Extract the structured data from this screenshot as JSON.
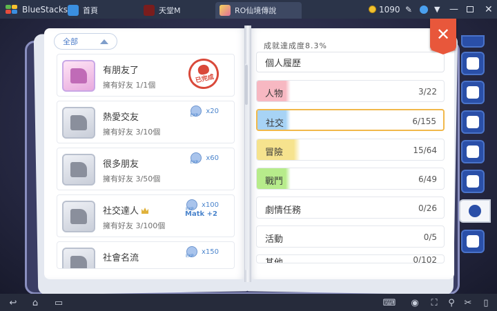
{
  "titlebar": {
    "app_name": "BlueStacks",
    "tabs": [
      {
        "label": "首頁",
        "icon": "home-icon"
      },
      {
        "label": "天堂M",
        "icon": "lineage-m-icon"
      },
      {
        "label": "RO仙境傳說",
        "icon": "ro-game-icon"
      }
    ],
    "coins": "1090",
    "icons": [
      "coin-icon",
      "pin-icon",
      "bluestacks-logo-icon",
      "minimize-icon",
      "maximize-icon",
      "close-icon"
    ]
  },
  "book": {
    "filter_label": "全部",
    "achievements": [
      {
        "name": "有朋友了",
        "desc": "擁有好友 1/1個",
        "completed": true,
        "stamp": "已完成"
      },
      {
        "name": "熱愛交友",
        "desc": "擁有好友 3/10個",
        "reward": "x20"
      },
      {
        "name": "很多朋友",
        "desc": "擁有好友 3/50個",
        "reward": "x60"
      },
      {
        "name": "社交達人",
        "desc": "擁有好友 3/100個",
        "reward": "x100",
        "bonus": "Matk +2"
      },
      {
        "name": "社會名流",
        "desc": "",
        "reward": "x150"
      }
    ],
    "progress_label": "成就達成度8.3%",
    "personal_label": "個人履歷",
    "categories": [
      {
        "label": "人物",
        "count": "3/22",
        "fraction": 0.136,
        "color": "#f7b8c2"
      },
      {
        "label": "社交",
        "count": "6/155",
        "fraction": 0.039,
        "color": "#a7d3f5",
        "selected": true
      },
      {
        "label": "冒險",
        "count": "15/64",
        "fraction": 0.234,
        "color": "#f6e38e"
      },
      {
        "label": "戰鬥",
        "count": "6/49",
        "fraction": 0.122,
        "color": "#b7ec8b"
      },
      {
        "label": "劇情任務",
        "count": "0/26",
        "fraction": 0
      },
      {
        "label": "活動",
        "count": "0/5",
        "fraction": 0
      },
      {
        "label": "其他",
        "count": "0/102",
        "fraction": 0
      }
    ]
  },
  "side_tabs": [
    "pet-icon",
    "guild-icon",
    "book-icon",
    "card-icon",
    "bag-icon",
    "medal-icon",
    "compass-icon"
  ],
  "navbar": {
    "icons": [
      "back-icon",
      "home-icon",
      "recent-apps-icon",
      "keyboard-icon",
      "eye-icon",
      "fullscreen-icon",
      "location-icon",
      "scissors-icon",
      "phone-icon"
    ]
  }
}
